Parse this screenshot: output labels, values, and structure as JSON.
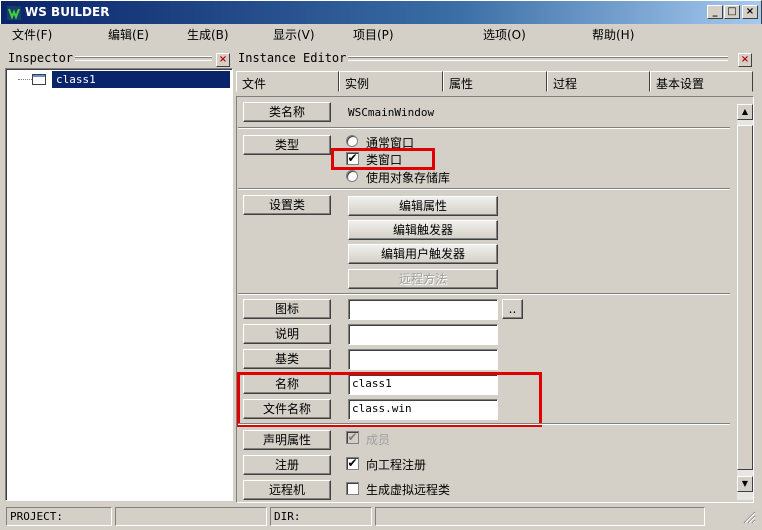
{
  "window": {
    "title": "WS BUILDER",
    "min": "_",
    "max": "□",
    "close": "×"
  },
  "menu": [
    "文件(F)",
    "编辑(E)",
    "生成(B)",
    "显示(V)",
    "项目(P)",
    "选项(O)",
    "帮助(H)"
  ],
  "inspector": {
    "title": "Inspector",
    "close": "×",
    "tree_item": "class1"
  },
  "instance_editor": {
    "title": "Instance Editor",
    "close": "×"
  },
  "tabs": [
    "文件",
    "实例",
    "属性",
    "过程",
    "基本设置"
  ],
  "form": {
    "class_name_label": "类名称",
    "class_name_value": "WSCmainWindow",
    "type_label": "类型",
    "type_options": [
      "通常窗口",
      "类窗口",
      "使用对象存储库"
    ],
    "type_checked": "类窗口",
    "setup_label": "设置类",
    "setup_buttons": [
      "编辑属性",
      "编辑触发器",
      "编辑用户触发器",
      "远程方法"
    ],
    "icon_label": "图标",
    "icon_value": "",
    "browse_label": "..",
    "desc_label": "说明",
    "desc_value": "",
    "base_label": "基类",
    "base_value": "",
    "name_label": "名称",
    "name_value": "class1",
    "filename_label": "文件名称",
    "filename_value": "class.win",
    "declare_label": "声明属性",
    "declare_check": "成员",
    "register_label": "注册",
    "register_check": "向工程注册",
    "remote_label": "远程机",
    "remote_check": "生成虚拟远程类"
  },
  "status": {
    "project": "PROJECT:",
    "dir": "DIR:"
  },
  "colors": {
    "title_start": "#0a246a",
    "title_end": "#a6caf0",
    "selection": "#0a246a",
    "highlight_box": "#e00000"
  }
}
